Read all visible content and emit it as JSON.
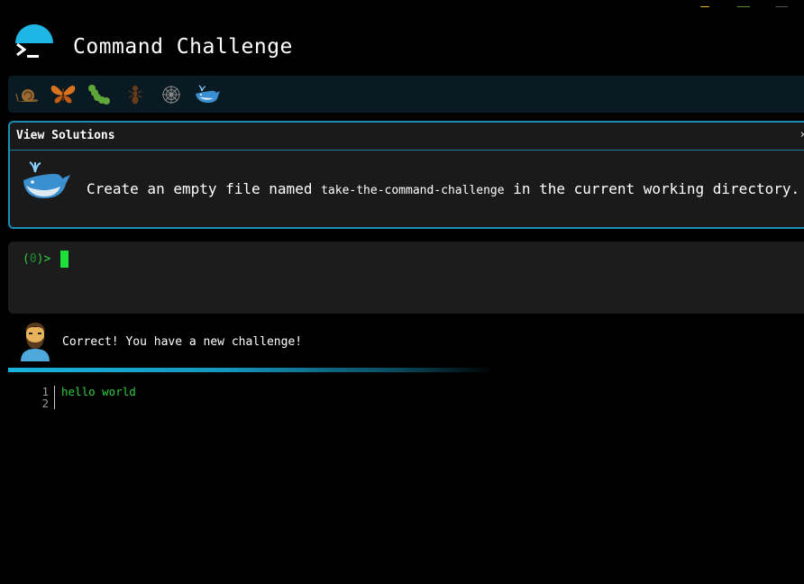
{
  "header": {
    "title": "Command Challenge"
  },
  "levels": [
    {
      "name": "snail-icon"
    },
    {
      "name": "butterfly-icon"
    },
    {
      "name": "caterpillar-icon"
    },
    {
      "name": "ant-icon"
    },
    {
      "name": "spider-web-icon"
    },
    {
      "name": "whale-icon"
    }
  ],
  "challenge": {
    "view_solutions_label": "View Solutions",
    "close_label": "×",
    "text_before": "Create an empty file named ",
    "filename": "take-the-command-challenge",
    "text_after": " in the current working directory."
  },
  "terminal": {
    "prompt_open": "(",
    "prompt_count": "0",
    "prompt_close": ")>"
  },
  "message": {
    "text": "Correct! You have a new challenge!"
  },
  "output": {
    "lines": [
      {
        "number": "1",
        "text": "hello world"
      },
      {
        "number": "2",
        "text": ""
      }
    ]
  },
  "colors": {
    "accent": "#1fb6e6",
    "prompt_green": "#2ecc40",
    "panel_border": "#1a8fb3"
  }
}
